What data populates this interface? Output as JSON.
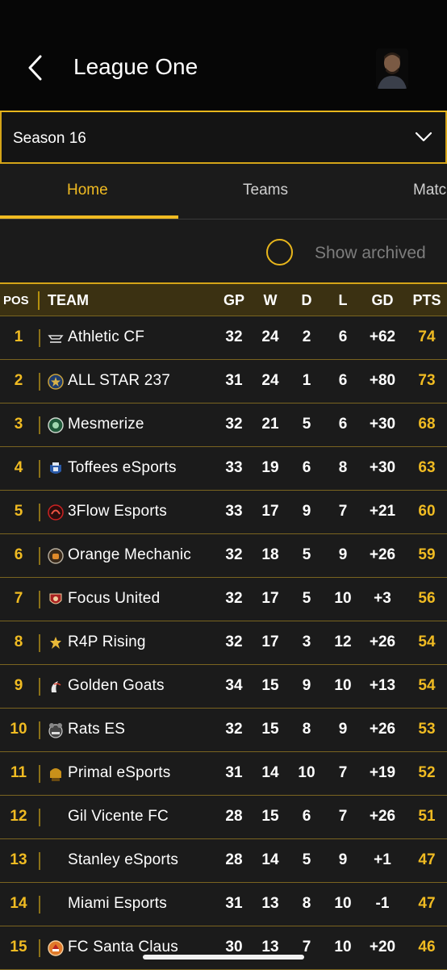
{
  "header": {
    "title": "League One"
  },
  "season": {
    "selected": "Season 16"
  },
  "tabs": [
    {
      "label": "Home"
    },
    {
      "label": "Teams"
    },
    {
      "label": "Matc"
    }
  ],
  "archived": {
    "label": "Show archived"
  },
  "table": {
    "columns": {
      "pos": "POS",
      "team": "TEAM",
      "gp": "GP",
      "w": "W",
      "d": "D",
      "l": "L",
      "gd": "GD",
      "pts": "PTS"
    },
    "rows": [
      {
        "pos": "1",
        "team": "Athletic CF",
        "gp": "32",
        "w": "24",
        "d": "2",
        "l": "6",
        "gd": "+62",
        "pts": "74",
        "logo": "athletic-logo"
      },
      {
        "pos": "2",
        "team": "ALL STAR 237",
        "gp": "31",
        "w": "24",
        "d": "1",
        "l": "6",
        "gd": "+80",
        "pts": "73",
        "logo": "allstar-logo"
      },
      {
        "pos": "3",
        "team": "Mesmerize",
        "gp": "32",
        "w": "21",
        "d": "5",
        "l": "6",
        "gd": "+30",
        "pts": "68",
        "logo": "mesmerize-logo"
      },
      {
        "pos": "4",
        "team": "Toffees eSports",
        "gp": "33",
        "w": "19",
        "d": "6",
        "l": "8",
        "gd": "+30",
        "pts": "63",
        "logo": "toffees-logo"
      },
      {
        "pos": "5",
        "team": "3Flow Esports",
        "gp": "33",
        "w": "17",
        "d": "9",
        "l": "7",
        "gd": "+21",
        "pts": "60",
        "logo": "3flow-logo"
      },
      {
        "pos": "6",
        "team": "Orange Mechanic",
        "gp": "32",
        "w": "18",
        "d": "5",
        "l": "9",
        "gd": "+26",
        "pts": "59",
        "logo": "orange-logo"
      },
      {
        "pos": "7",
        "team": "Focus United",
        "gp": "32",
        "w": "17",
        "d": "5",
        "l": "10",
        "gd": "+3",
        "pts": "56",
        "logo": "focus-logo"
      },
      {
        "pos": "8",
        "team": "R4P Rising",
        "gp": "32",
        "w": "17",
        "d": "3",
        "l": "12",
        "gd": "+26",
        "pts": "54",
        "logo": "r4p-logo"
      },
      {
        "pos": "9",
        "team": "Golden Goats",
        "gp": "34",
        "w": "15",
        "d": "9",
        "l": "10",
        "gd": "+13",
        "pts": "54",
        "logo": "goats-logo"
      },
      {
        "pos": "10",
        "team": "Rats ES",
        "gp": "32",
        "w": "15",
        "d": "8",
        "l": "9",
        "gd": "+26",
        "pts": "53",
        "logo": "rats-logo"
      },
      {
        "pos": "11",
        "team": "Primal eSports",
        "gp": "31",
        "w": "14",
        "d": "10",
        "l": "7",
        "gd": "+19",
        "pts": "52",
        "logo": "primal-logo"
      },
      {
        "pos": "12",
        "team": "Gil Vicente FC",
        "gp": "28",
        "w": "15",
        "d": "6",
        "l": "7",
        "gd": "+26",
        "pts": "51",
        "logo": ""
      },
      {
        "pos": "13",
        "team": "Stanley eSports",
        "gp": "28",
        "w": "14",
        "d": "5",
        "l": "9",
        "gd": "+1",
        "pts": "47",
        "logo": ""
      },
      {
        "pos": "14",
        "team": "Miami Esports",
        "gp": "31",
        "w": "13",
        "d": "8",
        "l": "10",
        "gd": "-1",
        "pts": "47",
        "logo": ""
      },
      {
        "pos": "15",
        "team": "FC Santa Claus",
        "gp": "30",
        "w": "13",
        "d": "7",
        "l": "10",
        "gd": "+20",
        "pts": "46",
        "logo": "santaclaus-logo"
      }
    ]
  },
  "colors": {
    "accent": "#f0bb22",
    "background": "#1b1b1b",
    "header": "#060606"
  }
}
